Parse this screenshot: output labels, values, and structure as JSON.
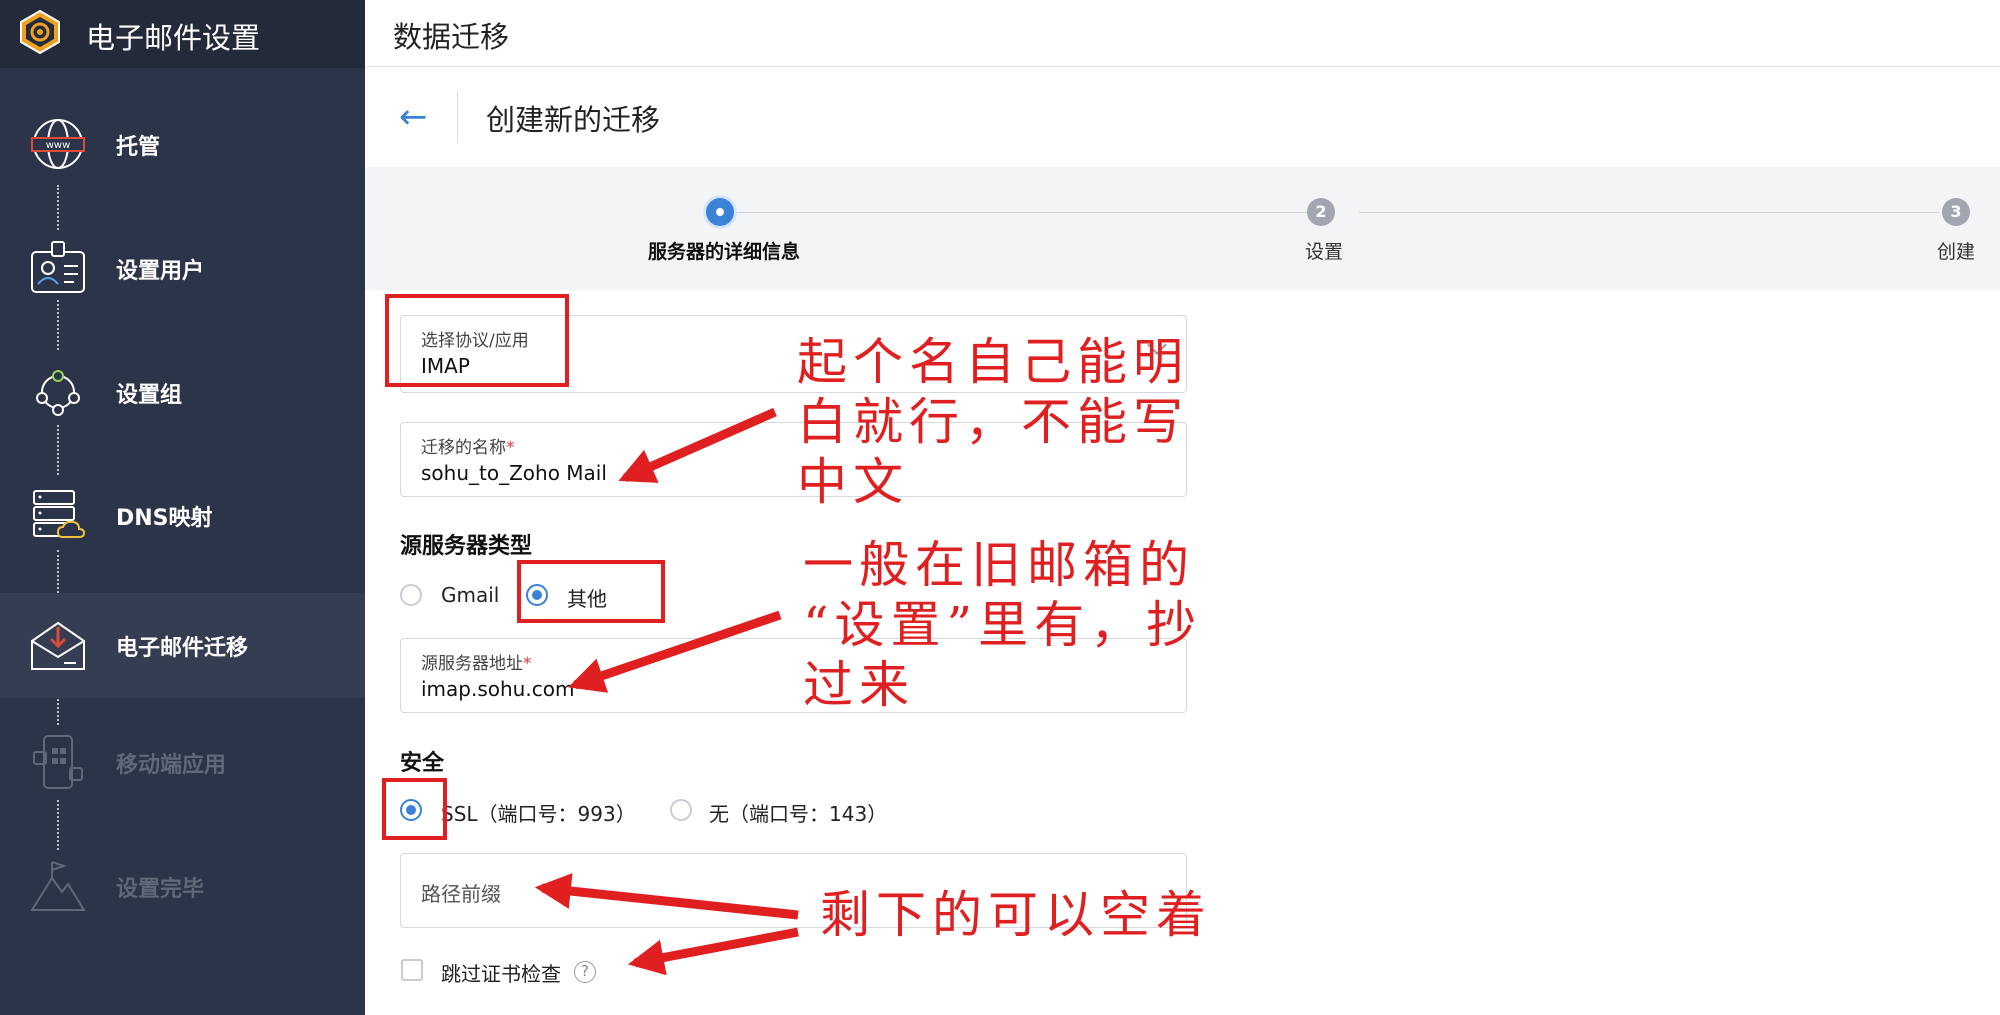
{
  "sidebar": {
    "app_title": "电子邮件设置",
    "items": [
      {
        "label": "托管",
        "icon": "www-globe-icon",
        "state": "normal"
      },
      {
        "label": "设置用户",
        "icon": "user-card-icon",
        "state": "normal"
      },
      {
        "label": "设置组",
        "icon": "user-group-icon",
        "state": "normal"
      },
      {
        "label": "DNS映射",
        "icon": "dns-server-icon",
        "state": "normal"
      },
      {
        "label": "电子邮件迁移",
        "icon": "mail-migration-icon",
        "state": "active"
      },
      {
        "label": "移动端应用",
        "icon": "mobile-app-icon",
        "state": "disabled"
      },
      {
        "label": "设置完毕",
        "icon": "mountain-flag-icon",
        "state": "disabled"
      }
    ]
  },
  "main": {
    "page_title": "数据迁移",
    "sub_title": "创建新的迁移",
    "stepper": [
      {
        "number": "",
        "label": "服务器的详细信息",
        "state": "active"
      },
      {
        "number": "2",
        "label": "设置",
        "state": "pending"
      },
      {
        "number": "3",
        "label": "创建",
        "state": "pending"
      }
    ],
    "form": {
      "protocol": {
        "label": "选择协议/应用",
        "value": "IMAP"
      },
      "migration_name": {
        "label": "迁移的名称",
        "required_mark": "*",
        "value": "sohu_to_Zoho Mail"
      },
      "source_type": {
        "title": "源服务器类型",
        "options": [
          "Gmail",
          "其他"
        ],
        "selected": "其他"
      },
      "server_address": {
        "label": "源服务器地址",
        "required_mark": "*",
        "value": "imap.sohu.com"
      },
      "security": {
        "title": "安全",
        "options": [
          "SSL（端口号：993）",
          "无（端口号：143）"
        ],
        "selected": "SSL（端口号：993）"
      },
      "path_prefix": {
        "placeholder": "路径前缀"
      },
      "skip_cert": {
        "label": "跳过证书检查",
        "help": "?"
      }
    }
  },
  "annotations": {
    "name_tip": "起个名自己能明\n白就行，不能写\n中文",
    "server_tip": "一般在旧邮箱的\n“设置”里有，抄\n过来",
    "empty_tip": "剩下的可以空着"
  },
  "colors": {
    "accent": "#3b82d6",
    "sidebar_bg": "#2b3448",
    "annotation_red": "#e02020"
  }
}
